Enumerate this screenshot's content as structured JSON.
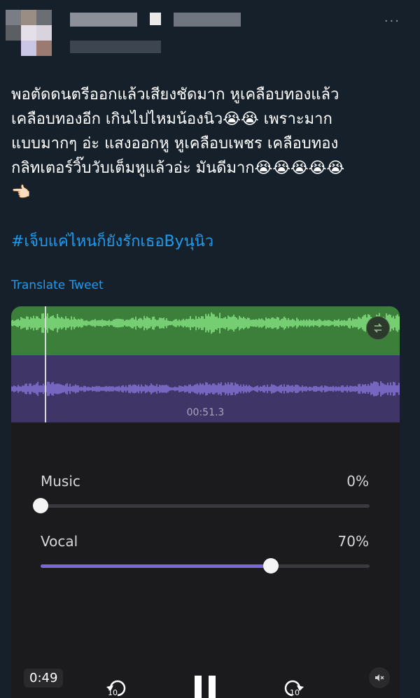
{
  "tweet": {
    "more_label": "···",
    "text": "พอตัดดนตรีออกแล้วเสียงชัดมาก หูเคลือบทองแล้ว\nเคลือบทองอีก เกินไปไหมน้องนิว😭😭 เพราะมาก\nแบบมากๆ อ่ะ แสงออกหู หูเคลือบเพชร เคลือบทอง\nกลิทเตอร์วิ๊บวับเต็มหูแล้วอ่ะ มันดีมาก😭😭😭😭😭\n👈🏻",
    "hashtag": "#เจ็บแค่ไหนก็ยังรักเธอByนุนิว",
    "translate_label": "Translate Tweet"
  },
  "player": {
    "waveform_timestamp": "00:51.3",
    "swap_icon": "swap-tracks-icon",
    "music": {
      "label": "Music",
      "value_text": "0%",
      "level": 0.0
    },
    "vocal": {
      "label": "Vocal",
      "value_text": "70%",
      "level": 0.7
    },
    "elapsed": "0:49",
    "rewind_label": "10",
    "forward_label": "10",
    "colors": {
      "music_wave_bg": "#3c7f3a",
      "music_wave": "#8ef08a",
      "vocal_wave_bg": "#3f3566",
      "vocal_wave": "#8e7ce6",
      "slider_fill": "#7a68d6",
      "link": "#1d9bf0"
    }
  }
}
